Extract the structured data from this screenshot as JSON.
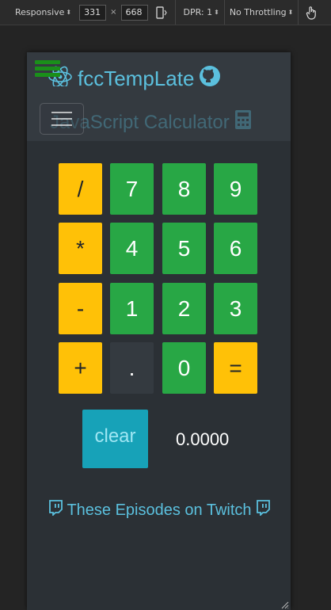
{
  "devtools": {
    "device": "Responsive",
    "width": "331",
    "height": "668",
    "times": "×",
    "dpr": "DPR: 1",
    "throttling": "No Throttling",
    "icons": [
      "rotate-icon",
      "touch-icon",
      "chevron-updown-icon"
    ]
  },
  "navbar": {
    "brand": "fccTempLate",
    "brand_icons": [
      "fire-react-icon",
      "github-icon"
    ],
    "menu_icon": "hamburger-icon",
    "subtitle": "JavaScript Calculator",
    "subtitle_icon": "calculator-icon"
  },
  "calculator": {
    "keys": [
      {
        "label": "/",
        "kind": "op"
      },
      {
        "label": "7",
        "kind": "num"
      },
      {
        "label": "8",
        "kind": "num"
      },
      {
        "label": "9",
        "kind": "num"
      },
      {
        "label": "*",
        "kind": "op"
      },
      {
        "label": "4",
        "kind": "num"
      },
      {
        "label": "5",
        "kind": "num"
      },
      {
        "label": "6",
        "kind": "num"
      },
      {
        "label": "-",
        "kind": "op"
      },
      {
        "label": "1",
        "kind": "num"
      },
      {
        "label": "2",
        "kind": "num"
      },
      {
        "label": "3",
        "kind": "num"
      },
      {
        "label": "+",
        "kind": "op"
      },
      {
        "label": ".",
        "kind": "dot"
      },
      {
        "label": "0",
        "kind": "num"
      },
      {
        "label": "=",
        "kind": "op"
      }
    ],
    "clear_label": "clear",
    "display": "0.0000"
  },
  "footer": {
    "link_text": "These Episodes on Twitch",
    "icon": "twitch-icon"
  },
  "colors": {
    "operator": "#ffc107",
    "number": "#28a745",
    "dot": "#343a40",
    "clear": "#17a2b8",
    "link": "#5bc0de",
    "background": "#2b3035"
  }
}
